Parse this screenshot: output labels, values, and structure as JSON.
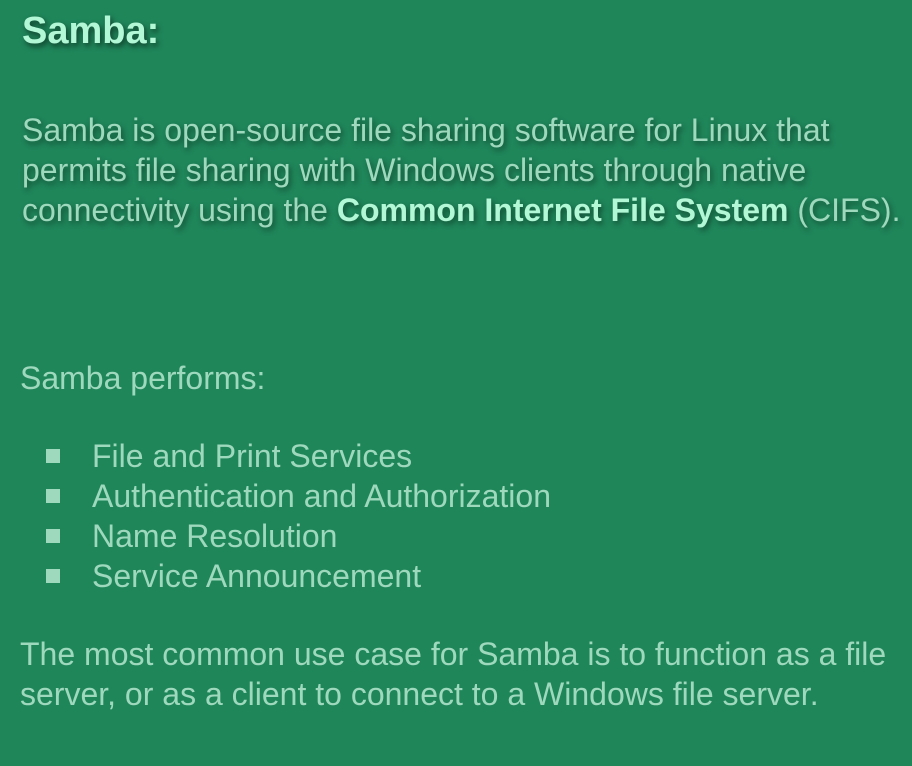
{
  "title": "Samba:",
  "intro": {
    "text_before": "Samba is open-source file sharing software for Linux that permits file sharing with Windows clients through native connectivity using the ",
    "emphasis": "Common Internet File System",
    "text_after": " (CIFS)."
  },
  "performs_label": "Samba performs:",
  "services": [
    "File and Print Services",
    "Authentication and Authorization",
    "Name Resolution",
    "Service Announcement"
  ],
  "closing": "The most common use case for Samba is to function as a file server, or as a client to connect to a Windows file server.",
  "colors": {
    "background": "#1f865a",
    "heading": "#b2f7d6",
    "body_text": "#9ed8bd"
  }
}
